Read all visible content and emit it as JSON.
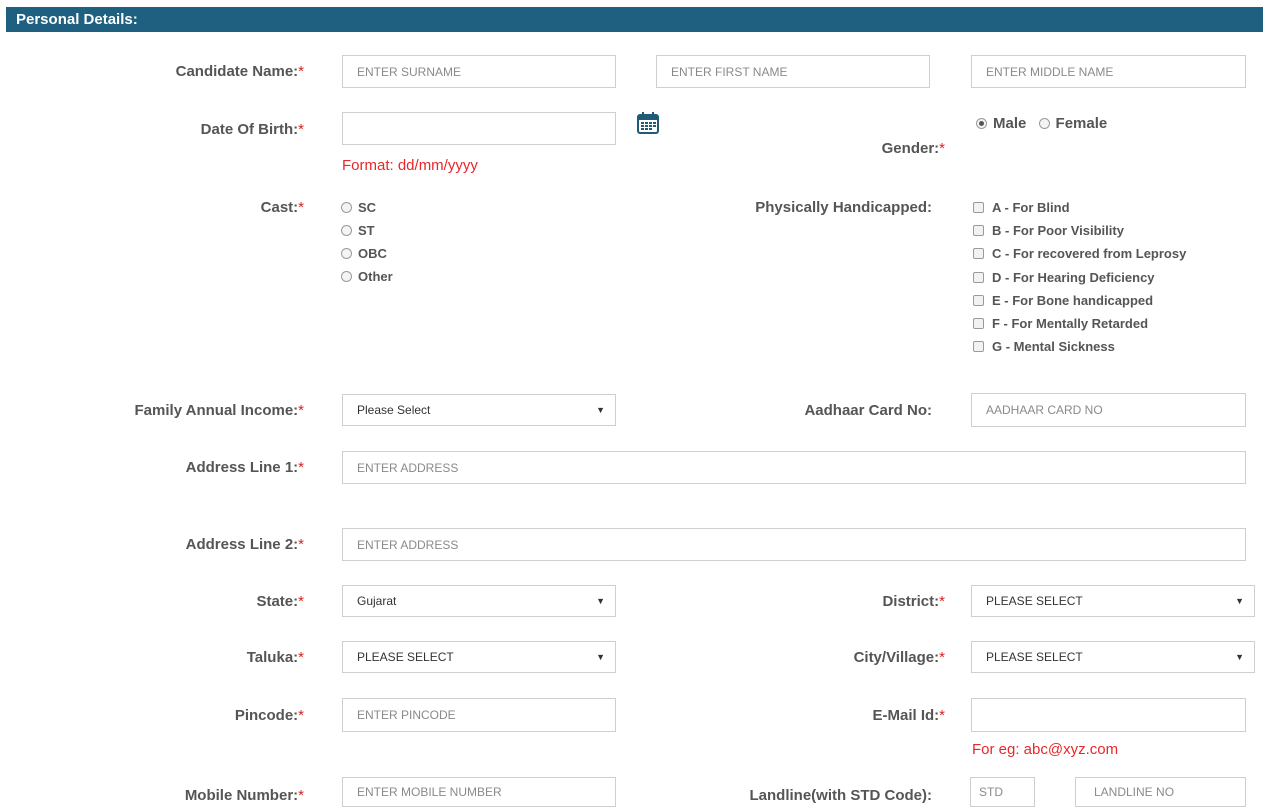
{
  "section_title": "Personal Details:",
  "required_mark": "*",
  "labels": {
    "candidate_name": "Candidate Name:",
    "dob": "Date Of Birth:",
    "gender": "Gender:",
    "cast": "Cast:",
    "handicapped": "Physically Handicapped:",
    "income": "Family Annual Income:",
    "aadhaar": "Aadhaar Card No:",
    "address1": "Address Line 1:",
    "address2": "Address Line 2:",
    "state": "State:",
    "district": "District:",
    "taluka": "Taluka:",
    "city": "City/Village:",
    "pincode": "Pincode:",
    "email": "E-Mail Id:",
    "mobile": "Mobile Number:",
    "landline": "Landline(with STD Code):"
  },
  "placeholders": {
    "surname": "ENTER SURNAME",
    "first_name": "ENTER FIRST NAME",
    "middle_name": "ENTER MIDDLE NAME",
    "aadhaar": "AADHAAR CARD NO",
    "address1": "ENTER ADDRESS",
    "address2": "ENTER ADDRESS",
    "pincode": "ENTER PINCODE",
    "mobile": "ENTER MOBILE NUMBER",
    "std": "STD",
    "landline": "LANDLINE NO"
  },
  "values": {
    "dob": "",
    "email": ""
  },
  "hints": {
    "dob_format": "Format: dd/mm/yyyy",
    "email_example": "For eg: abc@xyz.com"
  },
  "gender": {
    "options": [
      "Male",
      "Female"
    ],
    "selected": "Male"
  },
  "cast_options": [
    "SC",
    "ST",
    "OBC",
    "Other"
  ],
  "handicap_options": [
    "A - For Blind",
    "B - For Poor Visibility",
    "C - For recovered from Leprosy",
    "D - For Hearing Deficiency",
    "E - For Bone handicapped",
    "F - For Mentally Retarded",
    "G - Mental Sickness"
  ],
  "selects": {
    "income": "Please Select",
    "state": "Gujarat",
    "district": "PLEASE SELECT",
    "taluka": "PLEASE SELECT",
    "city": "PLEASE SELECT"
  },
  "icons": {
    "calendar": "calendar-icon",
    "dropdown": "chevron-down-icon"
  },
  "colors": {
    "header_bg": "#1f6080",
    "required": "#e02020",
    "hint": "#e8272b",
    "calendar": "#1f5a78"
  }
}
